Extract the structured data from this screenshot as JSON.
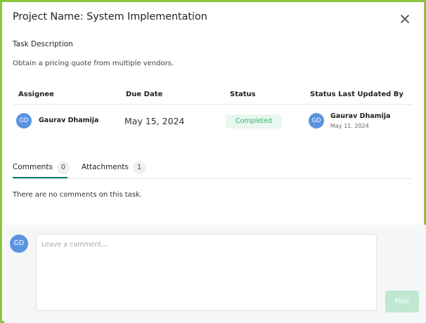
{
  "modal": {
    "title": "Project Name: System Implementation"
  },
  "task": {
    "label": "Task Description",
    "description": "Obtain a pricing quote from multiple vendors."
  },
  "table": {
    "headers": {
      "assignee": "Assignee",
      "due_date": "Due Date",
      "status": "Status",
      "updated_by": "Status Last Updated By"
    },
    "row": {
      "assignee_initials": "GD",
      "assignee_name": "Gaurav Dhamija",
      "due_date": "May 15, 2024",
      "status": "Completed",
      "updated_initials": "GD",
      "updated_name": "Gaurav Dhamija",
      "updated_date": "May 11, 2024"
    }
  },
  "tabs": [
    {
      "label": "Comments",
      "count": "0",
      "active": true
    },
    {
      "label": "Attachments",
      "count": "1",
      "active": false
    }
  ],
  "comments": {
    "empty_message": "There are no comments on this task.",
    "user_initials": "GD",
    "input_placeholder": "Leave a comment...",
    "post_label": "Post"
  },
  "colors": {
    "frame_border": "#8cc63f",
    "avatar": "#5b93df",
    "status_text": "#34b36a",
    "status_bg": "#e8f7ef",
    "active_tab": "#0f766e",
    "post_button": "#bfe7d1"
  },
  "icons": {
    "close": "close-icon"
  }
}
